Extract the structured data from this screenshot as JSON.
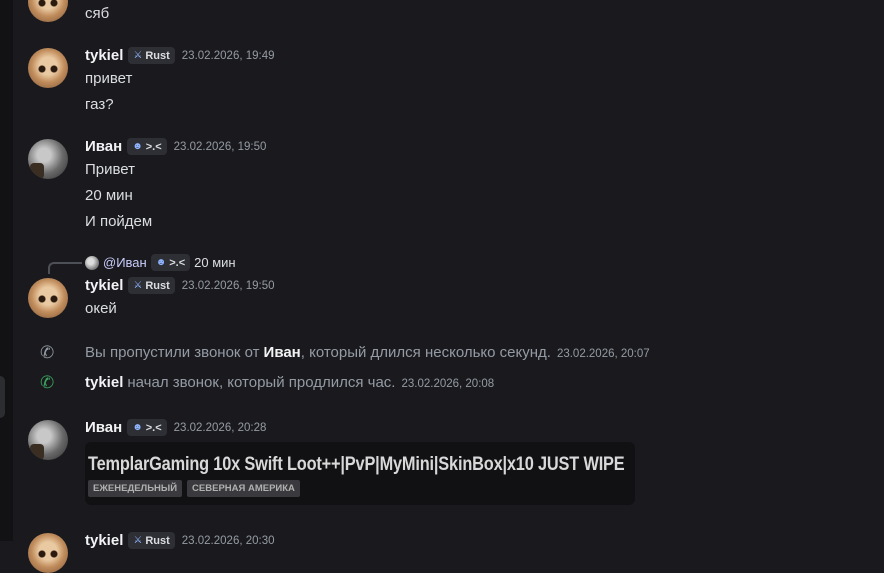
{
  "messages": {
    "m0": {
      "text": "сяб"
    },
    "m1": {
      "username": "tykiel",
      "tag": "Rust",
      "timestamp": "23.02.2026, 19:49",
      "lines": [
        "привет",
        "газ?"
      ]
    },
    "m2": {
      "username": "Иван",
      "tag": ">.<",
      "timestamp": "23.02.2026, 19:50",
      "lines": [
        "Привет",
        "20 мин",
        "И пойдем"
      ]
    },
    "m3": {
      "reply": {
        "mention": "@Иван",
        "tag": ">.<",
        "text": "20 мин"
      },
      "username": "tykiel",
      "tag": "Rust",
      "timestamp": "23.02.2026, 19:50",
      "lines": [
        "окей"
      ]
    },
    "call_missed": {
      "prefix": "Вы пропустили звонок от",
      "name": "Иван",
      "suffix": ", который длился несколько секунд.",
      "timestamp": "23.02.2026, 20:07"
    },
    "call_started": {
      "name": "tykiel",
      "suffix": "начал звонок, который продлился час.",
      "timestamp": "23.02.2026, 20:08"
    },
    "m4": {
      "username": "Иван",
      "tag": ">.<",
      "timestamp": "23.02.2026, 20:28",
      "embed": {
        "title": "TemplarGaming 10x Swift Loot++|PvP|MyMini|SkinBox|x10 JUST WIPE",
        "tags": [
          "ЕЖЕНЕДЕЛЬНЫЙ",
          "СЕВЕРНАЯ АМЕРИКА"
        ]
      }
    },
    "m5": {
      "username": "tykiel",
      "tag": "Rust",
      "timestamp": "23.02.2026, 20:30"
    }
  },
  "icons": {
    "rust_tag": "sword-icon",
    "ivan_tag": "bot-face-icon",
    "missed": "phone-missed-icon",
    "started": "phone-icon"
  },
  "colors": {
    "background": "#1a1a1e",
    "call_green": "#3ba55d"
  }
}
